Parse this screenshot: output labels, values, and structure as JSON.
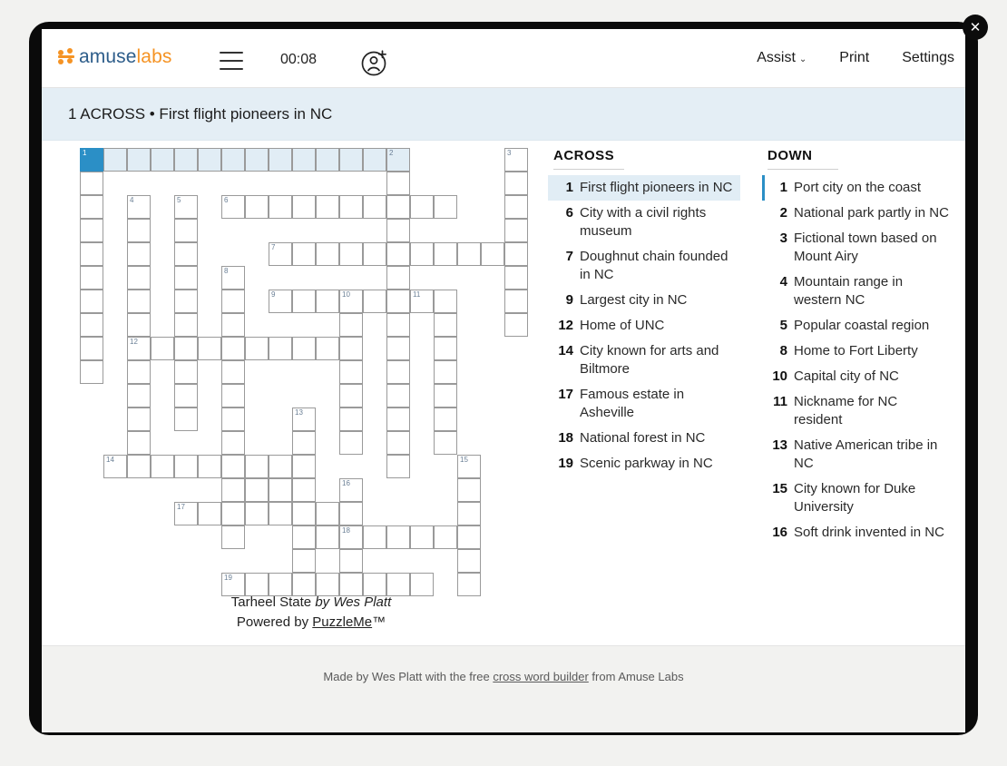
{
  "window": {
    "close_label": "✕"
  },
  "topbar": {
    "logo_amuse": "amuse",
    "logo_labs": "labs",
    "timer": "00:08",
    "menu_icon": "hamburger-icon",
    "account_icon": "add-account-icon",
    "nav": [
      {
        "label": "Assist",
        "caret": "⌄"
      },
      {
        "label": "Print",
        "caret": ""
      },
      {
        "label": "Settings",
        "caret": ""
      }
    ]
  },
  "clue_banner": {
    "text": "1 ACROSS • First flight pioneers in NC"
  },
  "puzzle": {
    "title": "Tarheel State",
    "by_text": "by Wes Platt",
    "powered_prefix": "Powered by ",
    "powered_link": "PuzzleMe",
    "powered_suffix": "™",
    "cols": 20,
    "rows": 19,
    "cell_size": 26,
    "active_cell": {
      "r": 0,
      "c": 0
    },
    "active_word": {
      "r": 0,
      "c0": 0,
      "c1": 13,
      "dir": "across"
    },
    "cells": [
      {
        "r": 0,
        "c": 0,
        "n": "1"
      },
      {
        "r": 0,
        "c": 1
      },
      {
        "r": 0,
        "c": 2
      },
      {
        "r": 0,
        "c": 3
      },
      {
        "r": 0,
        "c": 4
      },
      {
        "r": 0,
        "c": 5
      },
      {
        "r": 0,
        "c": 6
      },
      {
        "r": 0,
        "c": 7
      },
      {
        "r": 0,
        "c": 8
      },
      {
        "r": 0,
        "c": 9
      },
      {
        "r": 0,
        "c": 10
      },
      {
        "r": 0,
        "c": 11
      },
      {
        "r": 0,
        "c": 12
      },
      {
        "r": 0,
        "c": 13,
        "n": "2"
      },
      {
        "r": 0,
        "c": 18,
        "n": "3"
      },
      {
        "r": 1,
        "c": 0
      },
      {
        "r": 1,
        "c": 13
      },
      {
        "r": 1,
        "c": 18
      },
      {
        "r": 2,
        "c": 0
      },
      {
        "r": 2,
        "c": 2,
        "n": "4"
      },
      {
        "r": 2,
        "c": 4,
        "n": "5"
      },
      {
        "r": 2,
        "c": 6,
        "n": "6"
      },
      {
        "r": 2,
        "c": 7
      },
      {
        "r": 2,
        "c": 8
      },
      {
        "r": 2,
        "c": 9
      },
      {
        "r": 2,
        "c": 10
      },
      {
        "r": 2,
        "c": 11
      },
      {
        "r": 2,
        "c": 12
      },
      {
        "r": 2,
        "c": 13
      },
      {
        "r": 2,
        "c": 14
      },
      {
        "r": 2,
        "c": 15
      },
      {
        "r": 2,
        "c": 18
      },
      {
        "r": 3,
        "c": 0
      },
      {
        "r": 3,
        "c": 2
      },
      {
        "r": 3,
        "c": 4
      },
      {
        "r": 3,
        "c": 13
      },
      {
        "r": 3,
        "c": 18
      },
      {
        "r": 4,
        "c": 0
      },
      {
        "r": 4,
        "c": 2
      },
      {
        "r": 4,
        "c": 4
      },
      {
        "r": 4,
        "c": 8,
        "n": "7"
      },
      {
        "r": 4,
        "c": 9
      },
      {
        "r": 4,
        "c": 10
      },
      {
        "r": 4,
        "c": 11
      },
      {
        "r": 4,
        "c": 12
      },
      {
        "r": 4,
        "c": 13
      },
      {
        "r": 4,
        "c": 14
      },
      {
        "r": 4,
        "c": 15
      },
      {
        "r": 4,
        "c": 16
      },
      {
        "r": 4,
        "c": 17
      },
      {
        "r": 4,
        "c": 18
      },
      {
        "r": 5,
        "c": 0
      },
      {
        "r": 5,
        "c": 2
      },
      {
        "r": 5,
        "c": 4
      },
      {
        "r": 5,
        "c": 6,
        "n": "8"
      },
      {
        "r": 5,
        "c": 13
      },
      {
        "r": 5,
        "c": 18
      },
      {
        "r": 6,
        "c": 0
      },
      {
        "r": 6,
        "c": 2
      },
      {
        "r": 6,
        "c": 4
      },
      {
        "r": 6,
        "c": 6
      },
      {
        "r": 6,
        "c": 8,
        "n": "9"
      },
      {
        "r": 6,
        "c": 9
      },
      {
        "r": 6,
        "c": 10
      },
      {
        "r": 6,
        "c": 11,
        "n": "10"
      },
      {
        "r": 6,
        "c": 12
      },
      {
        "r": 6,
        "c": 13
      },
      {
        "r": 6,
        "c": 14,
        "n": "11"
      },
      {
        "r": 6,
        "c": 15
      },
      {
        "r": 6,
        "c": 18
      },
      {
        "r": 7,
        "c": 0
      },
      {
        "r": 7,
        "c": 2
      },
      {
        "r": 7,
        "c": 4
      },
      {
        "r": 7,
        "c": 6
      },
      {
        "r": 7,
        "c": 11
      },
      {
        "r": 7,
        "c": 13
      },
      {
        "r": 7,
        "c": 15
      },
      {
        "r": 7,
        "c": 18
      },
      {
        "r": 8,
        "c": 0
      },
      {
        "r": 8,
        "c": 2,
        "n": "12"
      },
      {
        "r": 8,
        "c": 3
      },
      {
        "r": 8,
        "c": 4
      },
      {
        "r": 8,
        "c": 5
      },
      {
        "r": 8,
        "c": 6
      },
      {
        "r": 8,
        "c": 7
      },
      {
        "r": 8,
        "c": 8
      },
      {
        "r": 8,
        "c": 9
      },
      {
        "r": 8,
        "c": 10
      },
      {
        "r": 8,
        "c": 11
      },
      {
        "r": 8,
        "c": 13
      },
      {
        "r": 8,
        "c": 15
      },
      {
        "r": 9,
        "c": 0
      },
      {
        "r": 9,
        "c": 2
      },
      {
        "r": 9,
        "c": 4
      },
      {
        "r": 9,
        "c": 6
      },
      {
        "r": 9,
        "c": 11
      },
      {
        "r": 9,
        "c": 13
      },
      {
        "r": 9,
        "c": 15
      },
      {
        "r": 10,
        "c": 2
      },
      {
        "r": 10,
        "c": 4
      },
      {
        "r": 10,
        "c": 6
      },
      {
        "r": 10,
        "c": 11
      },
      {
        "r": 10,
        "c": 13
      },
      {
        "r": 10,
        "c": 15
      },
      {
        "r": 11,
        "c": 2
      },
      {
        "r": 11,
        "c": 4
      },
      {
        "r": 11,
        "c": 6
      },
      {
        "r": 11,
        "c": 9,
        "n": "13"
      },
      {
        "r": 11,
        "c": 11
      },
      {
        "r": 11,
        "c": 13
      },
      {
        "r": 11,
        "c": 15
      },
      {
        "r": 12,
        "c": 2
      },
      {
        "r": 12,
        "c": 6
      },
      {
        "r": 12,
        "c": 9
      },
      {
        "r": 12,
        "c": 11
      },
      {
        "r": 12,
        "c": 13
      },
      {
        "r": 12,
        "c": 15
      },
      {
        "r": 13,
        "c": 1,
        "n": "14"
      },
      {
        "r": 13,
        "c": 2
      },
      {
        "r": 13,
        "c": 3
      },
      {
        "r": 13,
        "c": 4
      },
      {
        "r": 13,
        "c": 5
      },
      {
        "r": 13,
        "c": 6
      },
      {
        "r": 13,
        "c": 7
      },
      {
        "r": 13,
        "c": 8
      },
      {
        "r": 13,
        "c": 9
      },
      {
        "r": 13,
        "c": 13
      },
      {
        "r": 13,
        "c": 16,
        "n": "15"
      },
      {
        "r": 14,
        "c": 6
      },
      {
        "r": 14,
        "c": 7
      },
      {
        "r": 14,
        "c": 8
      },
      {
        "r": 14,
        "c": 9
      },
      {
        "r": 14,
        "c": 11,
        "n": "16"
      },
      {
        "r": 14,
        "c": 16
      },
      {
        "r": 15,
        "c": 4,
        "n": "17"
      },
      {
        "r": 15,
        "c": 5
      },
      {
        "r": 15,
        "c": 6
      },
      {
        "r": 15,
        "c": 7
      },
      {
        "r": 15,
        "c": 8
      },
      {
        "r": 15,
        "c": 9
      },
      {
        "r": 15,
        "c": 10
      },
      {
        "r": 15,
        "c": 11
      },
      {
        "r": 15,
        "c": 16
      },
      {
        "r": 16,
        "c": 6
      },
      {
        "r": 16,
        "c": 9
      },
      {
        "r": 16,
        "c": 10
      },
      {
        "r": 16,
        "c": 11,
        "n": "18"
      },
      {
        "r": 16,
        "c": 12
      },
      {
        "r": 16,
        "c": 13
      },
      {
        "r": 16,
        "c": 14
      },
      {
        "r": 16,
        "c": 15
      },
      {
        "r": 16,
        "c": 16
      },
      {
        "r": 17,
        "c": 9
      },
      {
        "r": 17,
        "c": 11
      },
      {
        "r": 17,
        "c": 16
      },
      {
        "r": 18,
        "c": 6,
        "n": "19"
      },
      {
        "r": 18,
        "c": 7
      },
      {
        "r": 18,
        "c": 8
      },
      {
        "r": 18,
        "c": 9
      },
      {
        "r": 18,
        "c": 10
      },
      {
        "r": 18,
        "c": 11
      },
      {
        "r": 18,
        "c": 12
      },
      {
        "r": 18,
        "c": 13
      },
      {
        "r": 18,
        "c": 14
      },
      {
        "r": 18,
        "c": 16
      }
    ]
  },
  "clue_lists": {
    "across": {
      "title": "ACROSS",
      "items": [
        {
          "n": "1",
          "text": "First flight pioneers in NC",
          "selected": true
        },
        {
          "n": "6",
          "text": "City with a civil rights museum"
        },
        {
          "n": "7",
          "text": "Doughnut chain founded in NC"
        },
        {
          "n": "9",
          "text": "Largest city in NC"
        },
        {
          "n": "12",
          "text": "Home of UNC"
        },
        {
          "n": "14",
          "text": "City known for arts and Biltmore"
        },
        {
          "n": "17",
          "text": "Famous estate in Asheville"
        },
        {
          "n": "18",
          "text": "National forest in NC"
        },
        {
          "n": "19",
          "text": "Scenic parkway in NC"
        }
      ]
    },
    "down": {
      "title": "DOWN",
      "items": [
        {
          "n": "1",
          "text": "Port city on the coast",
          "cursor": true
        },
        {
          "n": "2",
          "text": "National park partly in NC"
        },
        {
          "n": "3",
          "text": "Fictional town based on Mount Airy"
        },
        {
          "n": "4",
          "text": "Mountain range in western NC"
        },
        {
          "n": "5",
          "text": "Popular coastal region"
        },
        {
          "n": "8",
          "text": "Home to Fort Liberty"
        },
        {
          "n": "10",
          "text": "Capital city of NC"
        },
        {
          "n": "11",
          "text": "Nickname for NC resident"
        },
        {
          "n": "13",
          "text": "Native American tribe in NC"
        },
        {
          "n": "15",
          "text": "City known for Duke University"
        },
        {
          "n": "16",
          "text": "Soft drink invented in NC"
        }
      ]
    }
  },
  "footer": {
    "prefix": "Made by Wes Platt with the free ",
    "link": "cross word builder",
    "suffix": " from Amuse Labs"
  },
  "colors": {
    "accent": "#2b8fc6",
    "highlight": "#e1edf5",
    "banner": "#e4eef5",
    "logo_blue": "#2d5d8a",
    "logo_orange": "#f59324"
  }
}
